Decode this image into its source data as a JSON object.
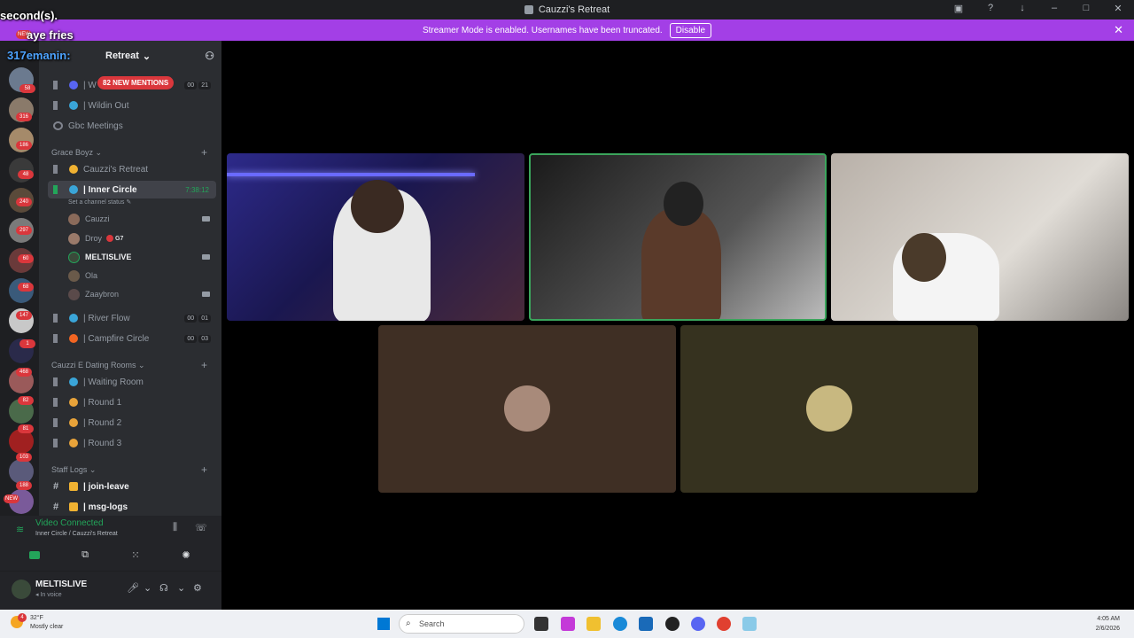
{
  "window": {
    "title": "Cauzzi's Retreat"
  },
  "banner": {
    "text": "Streamer Mode is enabled. Usernames have been truncated.",
    "button": "Disable"
  },
  "overlay": {
    "line1": "second(s).",
    "line2_name": "",
    "line2_text": "aye fries",
    "line3": "317emanin:"
  },
  "rail": {
    "badges": [
      "NEW",
      "58",
      "316",
      "186",
      "48",
      "240",
      "297",
      "60",
      "68",
      "147",
      "1",
      "468",
      "82",
      "81",
      "103",
      "188",
      "NEW"
    ]
  },
  "server": {
    "name": "Retreat",
    "mentions": "82 NEW MENTIONS"
  },
  "channels": {
    "top": [
      {
        "name": "| W",
        "counts": [
          "00",
          "21"
        ]
      },
      {
        "name": "| Wildin Out"
      },
      {
        "name": "Gbc Meetings"
      }
    ],
    "cat1": "Grace Boyz",
    "cat1_items": [
      {
        "name": "Cauzzi's Retreat"
      },
      {
        "name": "| Inner Circle",
        "timer": "7:38:12"
      }
    ],
    "status_hint": "Set a channel status",
    "members": [
      {
        "name": "Cauzzi"
      },
      {
        "name": "Droy",
        "tag": "G7"
      },
      {
        "name": "MELTISLIVE"
      },
      {
        "name": "Ola"
      },
      {
        "name": "Zaaybron"
      }
    ],
    "cat1_after": [
      {
        "name": "| River Flow",
        "counts": [
          "00",
          "01"
        ]
      },
      {
        "name": "| Campfire Circle",
        "counts": [
          "00",
          "03"
        ]
      }
    ],
    "cat2": "Cauzzi E Dating Rooms",
    "cat2_items": [
      {
        "name": "| Waiting Room"
      },
      {
        "name": "| Round 1"
      },
      {
        "name": "| Round 2"
      },
      {
        "name": "| Round 3"
      }
    ],
    "cat3": "Staff Logs",
    "cat3_items": [
      {
        "name": "| join-leave"
      },
      {
        "name": "| msg-logs"
      }
    ]
  },
  "voice": {
    "title": "Video Connected",
    "subtitle": "Inner Circle / Cauzzi's Retreat"
  },
  "user": {
    "name": "MELTISLIVE",
    "status": "In voice"
  },
  "taskbar": {
    "weather_temp": "32°F",
    "weather_desc": "Mostly clear",
    "search": "Search",
    "time": "4:05 AM",
    "date": "2/6/2026",
    "notif": "4"
  }
}
